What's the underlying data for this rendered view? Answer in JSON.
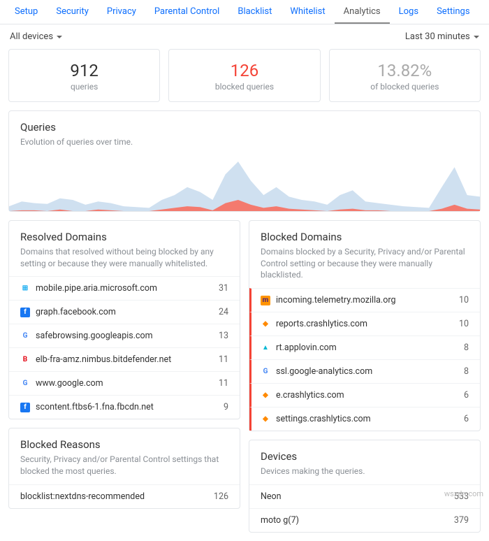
{
  "tabs": [
    "Setup",
    "Security",
    "Privacy",
    "Parental Control",
    "Blacklist",
    "Whitelist",
    "Analytics",
    "Logs",
    "Settings"
  ],
  "active_tab": "Analytics",
  "device_filter": "All devices",
  "time_filter": "Last 30 minutes",
  "stats": {
    "queries": {
      "value": "912",
      "label": "queries"
    },
    "blocked": {
      "value": "126",
      "label": "blocked queries"
    },
    "pct": {
      "value": "13.82%",
      "label": "of blocked queries"
    }
  },
  "queries_section": {
    "title": "Queries",
    "desc": "Evolution of queries over time."
  },
  "chart_data": {
    "type": "area",
    "title": "Queries",
    "xlabel": "",
    "ylabel": "",
    "series": [
      {
        "name": "queries",
        "color": "#cfe0f0",
        "values": [
          6,
          12,
          10,
          9,
          16,
          14,
          8,
          12,
          10,
          6,
          5,
          4,
          14,
          20,
          30,
          24,
          14,
          46,
          62,
          38,
          20,
          30,
          18,
          14,
          12,
          8,
          20,
          26,
          12,
          10,
          8,
          6,
          5,
          4,
          30,
          55,
          20,
          18
        ]
      },
      {
        "name": "blocked",
        "color": "#f47a6e",
        "values": [
          0,
          1,
          1,
          0,
          2,
          0,
          0,
          2,
          1,
          0,
          0,
          0,
          2,
          4,
          6,
          5,
          1,
          10,
          14,
          8,
          4,
          6,
          3,
          2,
          1,
          0,
          2,
          3,
          1,
          1,
          0,
          0,
          0,
          0,
          3,
          8,
          3,
          2
        ]
      }
    ],
    "ylim": [
      0,
      70
    ]
  },
  "resolved": {
    "title": "Resolved Domains",
    "desc": "Domains that resolved without being blocked by any setting or because they were manually whitelisted.",
    "items": [
      {
        "ico": "ms",
        "domain": "mobile.pipe.aria.microsoft.com",
        "count": 31
      },
      {
        "ico": "fb",
        "domain": "graph.facebook.com",
        "count": 24
      },
      {
        "ico": "g",
        "domain": "safebrowsing.googleapis.com",
        "count": 13
      },
      {
        "ico": "bd",
        "domain": "elb-fra-amz.nimbus.bitdefender.net",
        "count": 11
      },
      {
        "ico": "g",
        "domain": "www.google.com",
        "count": 11
      },
      {
        "ico": "fb",
        "domain": "scontent.ftbs6-1.fna.fbcdn.net",
        "count": 9
      }
    ]
  },
  "blocked": {
    "title": "Blocked Domains",
    "desc": "Domains blocked by a Security, Privacy and/or Parental Control setting or because they were manually blacklisted.",
    "items": [
      {
        "ico": "mz",
        "domain": "incoming.telemetry.mozilla.org",
        "count": 10
      },
      {
        "ico": "fi",
        "domain": "reports.crashlytics.com",
        "count": 10
      },
      {
        "ico": "al",
        "domain": "rt.applovin.com",
        "count": 8
      },
      {
        "ico": "g",
        "domain": "ssl.google-analytics.com",
        "count": 8
      },
      {
        "ico": "fi",
        "domain": "e.crashlytics.com",
        "count": 6
      },
      {
        "ico": "fi",
        "domain": "settings.crashlytics.com",
        "count": 6
      }
    ]
  },
  "reasons": {
    "title": "Blocked Reasons",
    "desc": "Security, Privacy and/or Parental Control settings that blocked the most queries.",
    "items": [
      {
        "domain": "blocklist:nextdns-recommended",
        "count": 126
      }
    ]
  },
  "devices": {
    "title": "Devices",
    "desc": "Devices making the queries.",
    "items": [
      {
        "domain": "Neon",
        "count": 533
      },
      {
        "domain": "moto g(7)",
        "count": 379
      }
    ]
  },
  "icons": {
    "ms": {
      "bg": "#fff",
      "fg": "#00a4ef",
      "inner": "⊞"
    },
    "fb": {
      "bg": "#1877f2",
      "fg": "#fff",
      "inner": "f"
    },
    "g": {
      "bg": "#fff",
      "fg": "#4285f4",
      "inner": "G"
    },
    "bd": {
      "bg": "#fff",
      "fg": "#e30613",
      "inner": "B"
    },
    "mz": {
      "bg": "#ff9400",
      "fg": "#4c1e7a",
      "inner": "m"
    },
    "fi": {
      "bg": "#fff",
      "fg": "#ff8a00",
      "inner": "◆"
    },
    "al": {
      "bg": "#fff",
      "fg": "#00b8d4",
      "inner": "▲"
    }
  },
  "watermark": "wsxdn.com"
}
